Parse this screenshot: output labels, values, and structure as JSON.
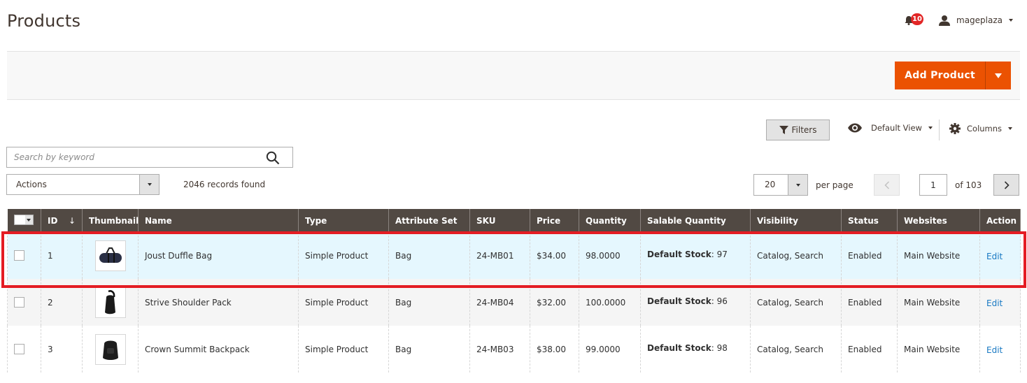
{
  "page": {
    "title": "Products"
  },
  "header": {
    "notifications": {
      "icon": "bell-icon",
      "count": "10"
    },
    "user": {
      "icon": "user-icon",
      "name": "mageplaza"
    }
  },
  "action_bar": {
    "add_product_label": "Add Product"
  },
  "toolbar": {
    "filters_label": "Filters",
    "view_label": "Default View",
    "columns_label": "Columns",
    "search_placeholder": "Search by keyword",
    "search_value": "",
    "mass_action_label": "Actions",
    "records_found": "2046 records found",
    "per_page_value": "20",
    "per_page_label": "per page",
    "current_page": "1",
    "total_pages_label": "of 103"
  },
  "colors": {
    "accent": "#eb5202",
    "header_bg": "#514943",
    "link": "#1979c3",
    "selected_row": "#e5f7fe",
    "highlight_border": "#e41c23",
    "badge": "#e22626"
  },
  "grid": {
    "columns": [
      "ID",
      "Thumbnail",
      "Name",
      "Type",
      "Attribute Set",
      "SKU",
      "Price",
      "Quantity",
      "Salable Quantity",
      "Visibility",
      "Status",
      "Websites",
      "Action"
    ],
    "sort_column": "ID",
    "sort_indicator": "↓",
    "rows": [
      {
        "id": "1",
        "thumbnail": "duffle-bag-image",
        "name": "Joust Duffle Bag",
        "type": "Simple Product",
        "attribute_set": "Bag",
        "sku": "24-MB01",
        "price": "$34.00",
        "quantity": "98.0000",
        "salable_label": "Default Stock",
        "salable_value": ": 97",
        "visibility": "Catalog, Search",
        "status": "Enabled",
        "websites": "Main Website",
        "action": "Edit",
        "highlighted": true
      },
      {
        "id": "2",
        "thumbnail": "shoulder-pack-image",
        "name": "Strive Shoulder Pack",
        "type": "Simple Product",
        "attribute_set": "Bag",
        "sku": "24-MB04",
        "price": "$32.00",
        "quantity": "100.0000",
        "salable_label": "Default Stock",
        "salable_value": ": 96",
        "visibility": "Catalog, Search",
        "status": "Enabled",
        "websites": "Main Website",
        "action": "Edit",
        "highlighted": false
      },
      {
        "id": "3",
        "thumbnail": "backpack-image",
        "name": "Crown Summit Backpack",
        "type": "Simple Product",
        "attribute_set": "Bag",
        "sku": "24-MB03",
        "price": "$38.00",
        "quantity": "99.0000",
        "salable_label": "Default Stock",
        "salable_value": ": 98",
        "visibility": "Catalog, Search",
        "status": "Enabled",
        "websites": "Main Website",
        "action": "Edit",
        "highlighted": false
      }
    ]
  }
}
